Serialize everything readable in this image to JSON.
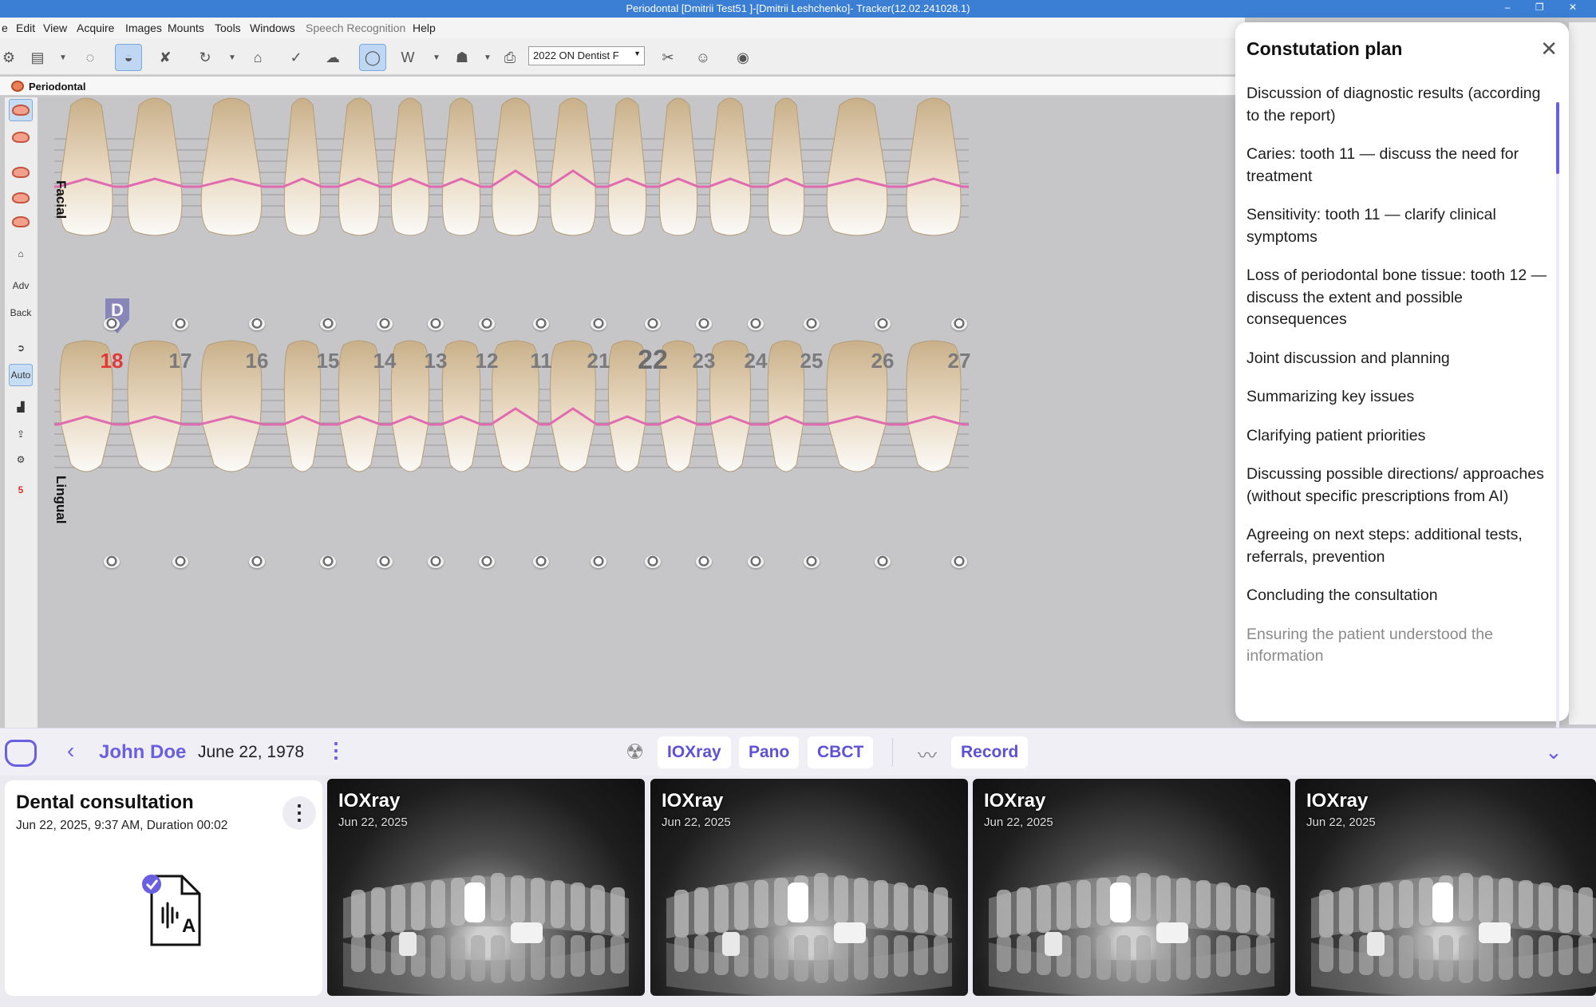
{
  "window": {
    "title": "Periodontal [Dmitrii Test51 ]-[Dmitrii Leshchenko]- Tracker(12.02.241028.1)",
    "controls": [
      "–",
      "❐",
      "✕"
    ]
  },
  "menu": [
    "e",
    "Edit",
    "View",
    "Acquire",
    "Images",
    "Mounts",
    "Tools",
    "Windows",
    "Speech Recognition",
    "Help"
  ],
  "toolbar": {
    "provider_select": "2022 ON Dentist F"
  },
  "subtab": {
    "label": "Periodontal"
  },
  "lefttools": {
    "adv": "Adv",
    "back": "Back",
    "auto": "Auto",
    "five": "5"
  },
  "chart": {
    "facial_label": "Facial",
    "lingual_label": "Lingual",
    "d_marker": "D",
    "upper_teeth": [
      "18",
      "17",
      "16",
      "15",
      "14",
      "13",
      "12",
      "11",
      "21",
      "22",
      "23",
      "24",
      "25",
      "26",
      "27"
    ],
    "highlight_red": "18",
    "highlight_large": "22",
    "gum_color": "#e06bb0"
  },
  "plan": {
    "title": "Constutation plan",
    "items": [
      "Discussion of diagnostic results (according to the report)",
      "Caries: tooth 11 — discuss the need for treatment",
      "Sensitivity: tooth 11 — clarify clinical symptoms",
      "Loss of periodontal bone tissue: tooth 12 — discuss the extent and possible consequences",
      "Joint discussion and planning",
      "Summarizing key issues",
      "Clarifying patient priorities",
      "Discussing possible directions/ approaches (without specific prescriptions from AI)",
      "Agreeing on next steps: additional tests, referrals, prevention",
      "Concluding the consultation",
      "Ensuring the patient understood the information"
    ]
  },
  "patient": {
    "name": "John Doe",
    "dob": "June 22, 1978"
  },
  "imaging_buttons": [
    "IOXray",
    "Pano",
    "CBCT"
  ],
  "record_button": "Record",
  "consultation": {
    "title": "Dental consultation",
    "meta": "Jun 22, 2025, 9:37 AM, Duration 00:02"
  },
  "xrays": [
    {
      "label": "IOXray",
      "date": "Jun 22, 2025"
    },
    {
      "label": "IOXray",
      "date": "Jun 22, 2025"
    },
    {
      "label": "IOXray",
      "date": "Jun 22, 2025"
    },
    {
      "label": "IOXray",
      "date": "Jun 22, 2025"
    }
  ],
  "colors": {
    "accent": "#6a5fe0",
    "titlebar": "#3b7fd4",
    "red_tooth": "#e23a3a"
  },
  "icons": [
    "close-icon",
    "back-chevron-icon",
    "kebab-icon",
    "radiation-icon",
    "waveform-icon",
    "chevron-down-icon",
    "audio-file-icon",
    "check-badge-icon",
    "app-logo-icon"
  ]
}
